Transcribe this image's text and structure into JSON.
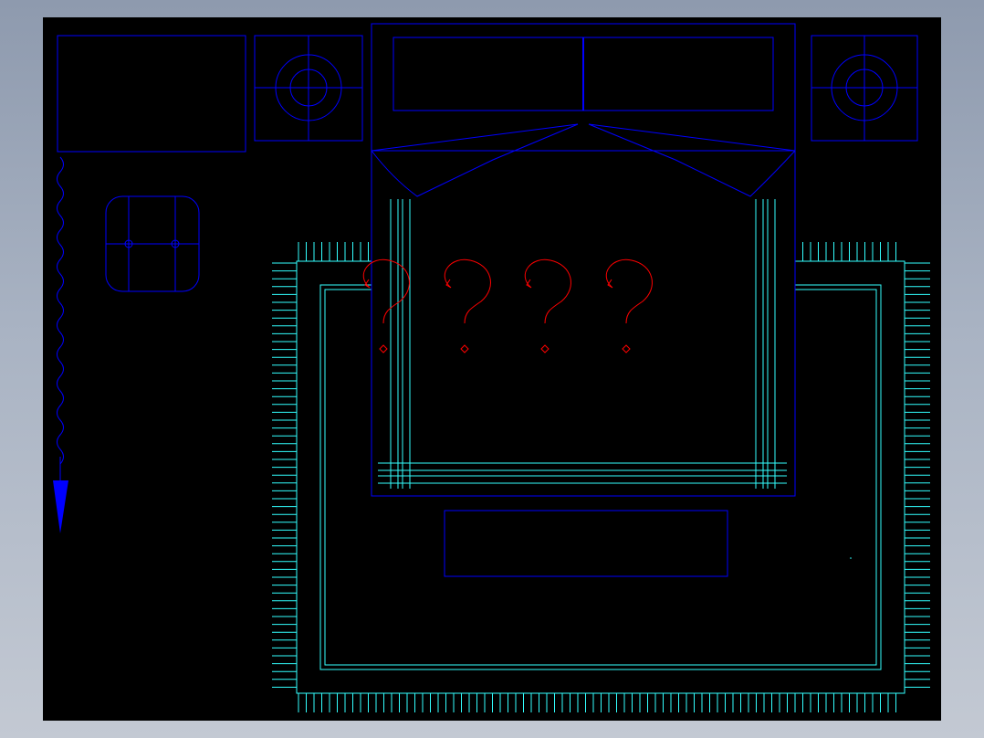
{
  "drawing": {
    "background": "#000000",
    "frame_color": "#a9b3c3",
    "layers": {
      "furniture": "#0000ff",
      "rug": "#33ffff",
      "annotation": "#ff0000"
    }
  },
  "annotation": {
    "marks": [
      "?",
      "?",
      "?",
      "?"
    ]
  },
  "icons": {
    "direction_arrow": "arrow-down-icon",
    "wavy_line": "wavy-line-icon"
  }
}
